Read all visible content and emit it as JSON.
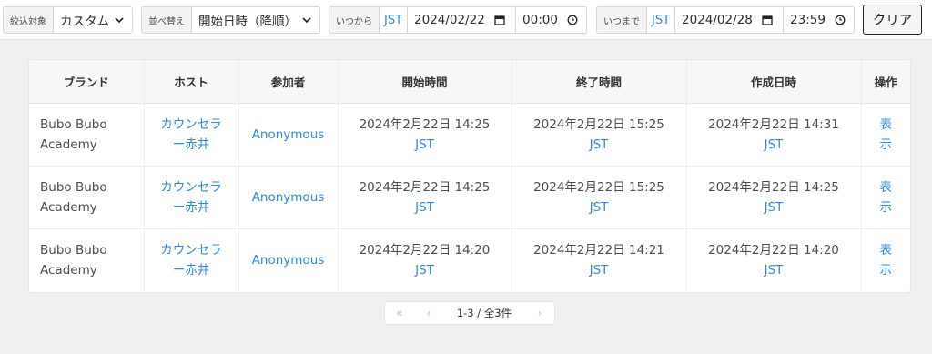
{
  "filters": {
    "target": {
      "label": "絞込対象",
      "value": "カスタム"
    },
    "sort": {
      "label": "並べ替え",
      "value": "開始日時（降順）"
    },
    "from": {
      "label": "いつから",
      "tz": "JST",
      "date": "2024/02/22",
      "time": "00:00"
    },
    "to": {
      "label": "いつまで",
      "tz": "JST",
      "date": "2024/02/28",
      "time": "23:59"
    },
    "clear_label": "クリア"
  },
  "table": {
    "headers": [
      "ブランド",
      "ホスト",
      "参加者",
      "開始時間",
      "終了時間",
      "作成日時",
      "操作"
    ],
    "rows": [
      {
        "brand": "Bubo Bubo Academy",
        "host_line1": "カウンセラ",
        "host_line2": "ー赤井",
        "participant": "Anonymous",
        "start": "2024年2月22日 14:25",
        "start_tz": "JST",
        "end": "2024年2月22日 15:25",
        "end_tz": "JST",
        "created": "2024年2月22日 14:31",
        "created_tz": "JST",
        "action_line1": "表",
        "action_line2": "示"
      },
      {
        "brand": "Bubo Bubo Academy",
        "host_line1": "カウンセラ",
        "host_line2": "ー赤井",
        "participant": "Anonymous",
        "start": "2024年2月22日 14:25",
        "start_tz": "JST",
        "end": "2024年2月22日 15:25",
        "end_tz": "JST",
        "created": "2024年2月22日 14:25",
        "created_tz": "JST",
        "action_line1": "表",
        "action_line2": "示"
      },
      {
        "brand": "Bubo Bubo Academy",
        "host_line1": "カウンセラ",
        "host_line2": "ー赤井",
        "participant": "Anonymous",
        "start": "2024年2月22日 14:20",
        "start_tz": "JST",
        "end": "2024年2月22日 14:21",
        "end_tz": "JST",
        "created": "2024年2月22日 14:20",
        "created_tz": "JST",
        "action_line1": "表",
        "action_line2": "示"
      }
    ]
  },
  "pagination": {
    "first": "«",
    "prev": "‹",
    "info": "1-3 / 全3件",
    "next": "›"
  },
  "colors": {
    "accent": "#2e8ae0",
    "background": "#f0f0f0"
  }
}
